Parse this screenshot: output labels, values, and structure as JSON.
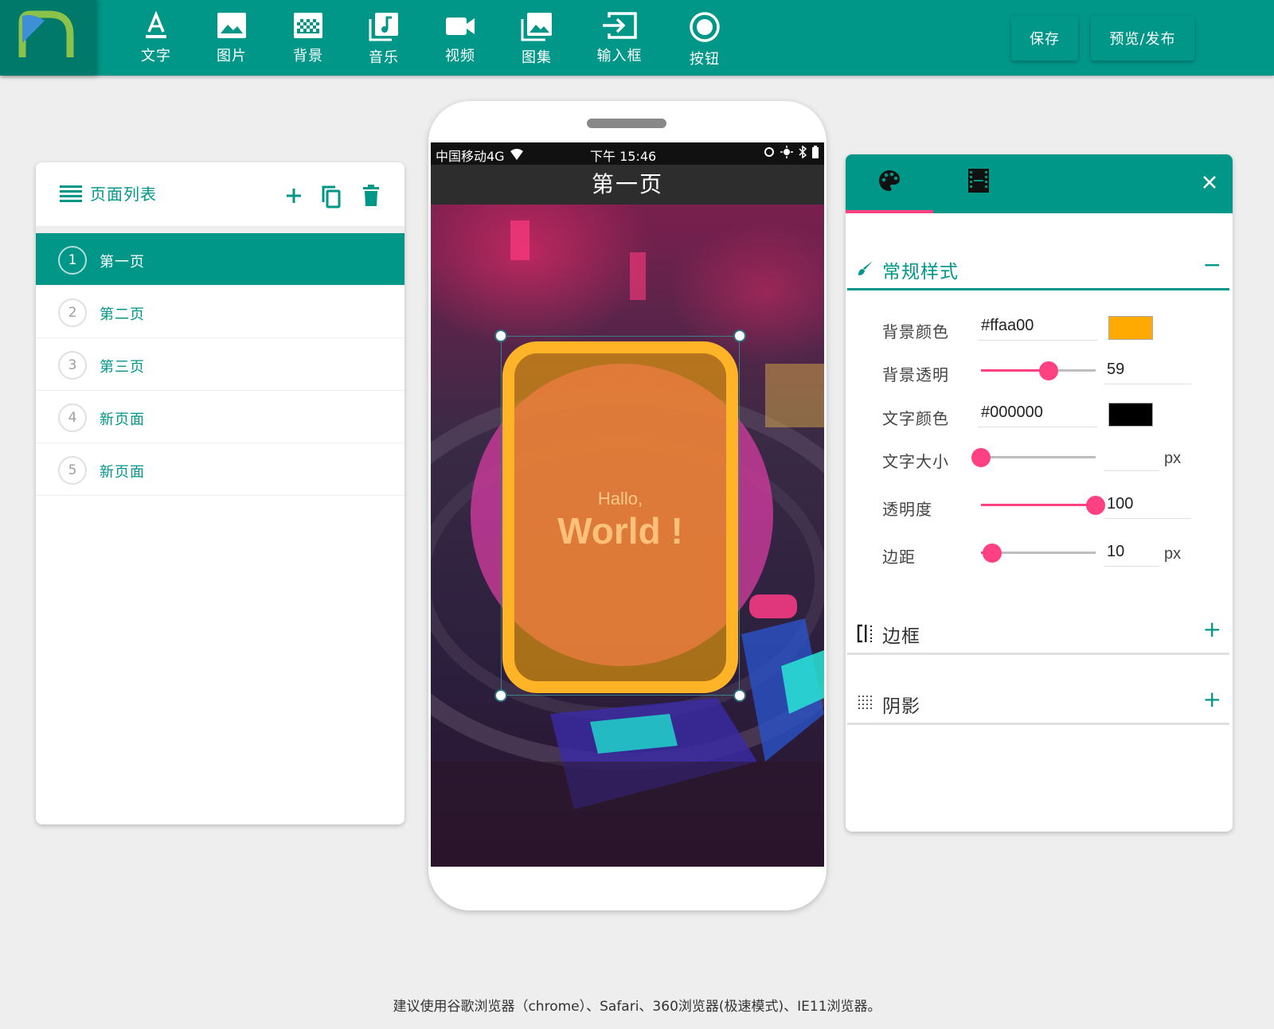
{
  "toolbar": {
    "items": [
      {
        "label": "文字",
        "icon": "text-icon"
      },
      {
        "label": "图片",
        "icon": "image-icon"
      },
      {
        "label": "背景",
        "icon": "background-icon"
      },
      {
        "label": "音乐",
        "icon": "music-icon"
      },
      {
        "label": "视频",
        "icon": "video-icon"
      },
      {
        "label": "图集",
        "icon": "gallery-icon"
      },
      {
        "label": "输入框",
        "icon": "input-icon"
      },
      {
        "label": "按钮",
        "icon": "button-icon"
      }
    ],
    "save_label": "保存",
    "publish_label": "预览/发布"
  },
  "page_list": {
    "title": "页面列表",
    "pages": [
      {
        "num": "1",
        "label": "第一页",
        "active": true
      },
      {
        "num": "2",
        "label": "第二页",
        "active": false
      },
      {
        "num": "3",
        "label": "第三页",
        "active": false
      },
      {
        "num": "4",
        "label": "新页面",
        "active": false
      },
      {
        "num": "5",
        "label": "新页面",
        "active": false
      }
    ]
  },
  "phone": {
    "carrier": "中国移动4G",
    "time": "下午 15:46",
    "page_title": "第一页",
    "card": {
      "line1": "Hallo,",
      "line2": "World !"
    }
  },
  "properties": {
    "section_general": "常规样式",
    "section_general_toggle": "−",
    "bg_color_label": "背景颜色",
    "bg_color_value": "#ffaa00",
    "bg_opacity_label": "背景透明",
    "bg_opacity_value": "59",
    "bg_opacity_fraction": 0.59,
    "text_color_label": "文字颜色",
    "text_color_value": "#000000",
    "font_size_label": "文字大小",
    "font_size_value": "",
    "font_size_fraction": 0,
    "font_size_unit": "px",
    "opacity_label": "透明度",
    "opacity_value": "100",
    "opacity_fraction": 1.0,
    "margin_label": "边距",
    "margin_value": "10",
    "margin_fraction": 0.1,
    "margin_unit": "px",
    "section_border": "边框",
    "section_border_toggle": "+",
    "section_shadow": "阴影",
    "section_shadow_toggle": "+"
  },
  "footer": {
    "note": "建议使用谷歌浏览器（chrome）、Safari、360浏览器(极速模式)、IE11浏览器。"
  },
  "colors": {
    "primary": "#009688",
    "accent": "#ff4081",
    "bg_swatch": "#ffaa00",
    "text_swatch": "#000000"
  }
}
